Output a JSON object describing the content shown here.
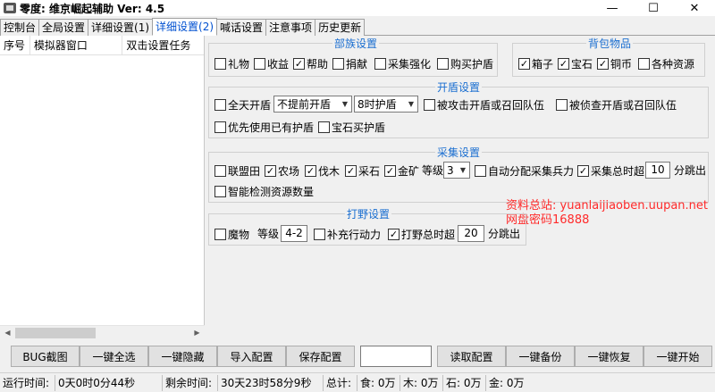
{
  "window": {
    "title": "零度: 维京崛起辅助 Ver:  4.5",
    "min": "—",
    "max": "☐",
    "close": "✕"
  },
  "tabs": [
    "控制台",
    "全局设置",
    "详细设置(1)",
    "详细设置(2)",
    "喊话设置",
    "注意事项",
    "历史更新"
  ],
  "list": {
    "columns": [
      "序号",
      "模拟器窗口",
      "双击设置任务"
    ]
  },
  "tribe": {
    "title": "部族设置",
    "items": [
      {
        "label": "礼物",
        "checked": false
      },
      {
        "label": "收益",
        "checked": false
      },
      {
        "label": "帮助",
        "checked": true
      },
      {
        "label": "捐献",
        "checked": false
      },
      {
        "label": "采集强化",
        "checked": false
      },
      {
        "label": "购买护盾",
        "checked": false
      }
    ]
  },
  "bag": {
    "title": "背包物品",
    "items": [
      {
        "label": "箱子",
        "checked": true
      },
      {
        "label": "宝石",
        "checked": true
      },
      {
        "label": "铜币",
        "checked": true
      },
      {
        "label": "各种资源",
        "checked": false
      }
    ]
  },
  "shield": {
    "title": "开盾设置",
    "allday": {
      "label": "全天开盾",
      "checked": false
    },
    "advance": "不提前开盾",
    "duration": "8时护盾",
    "attacked": {
      "label": "被攻击开盾或召回队伍",
      "checked": false
    },
    "scouted": {
      "label": "被侦查开盾或召回队伍",
      "checked": false
    },
    "use_existing": {
      "label": "优先使用已有护盾",
      "checked": false
    },
    "gem_buy": {
      "label": "宝石买护盾",
      "checked": false
    }
  },
  "gather": {
    "title": "采集设置",
    "items": [
      {
        "label": "联盟田",
        "checked": false
      },
      {
        "label": "农场",
        "checked": true
      },
      {
        "label": "伐木",
        "checked": true
      },
      {
        "label": "采石",
        "checked": true
      },
      {
        "label": "金矿",
        "checked": true
      }
    ],
    "level_label": "等级",
    "level": "3",
    "auto_alloc": {
      "label": "自动分配采集兵力",
      "checked": false
    },
    "total_timeout": {
      "label": "采集总时超",
      "checked": true
    },
    "timeout_value": "10",
    "timeout_suffix": "分跳出",
    "smart_detect": {
      "label": "智能检测资源数量",
      "checked": false
    }
  },
  "hunt": {
    "title": "打野设置",
    "monster": {
      "label": "魔物",
      "checked": false
    },
    "level_label": "等级",
    "level": "4-2",
    "refill": {
      "label": "补充行动力",
      "checked": false
    },
    "total_timeout": {
      "label": "打野总时超",
      "checked": true
    },
    "timeout_value": "20",
    "timeout_suffix": "分跳出"
  },
  "watermark": {
    "line1": "资料总站: yuanlaijiaoben.uupan.net",
    "line2": "网盘密码16888"
  },
  "buttons": [
    "BUG截图",
    "一键全选",
    "一键隐藏",
    "导入配置",
    "保存配置",
    "读取配置",
    "一键备份",
    "一键恢复",
    "一键开始"
  ],
  "status": {
    "run_label": "运行时间:",
    "run_value": "0天0时0分44秒",
    "remain_label": "剩余时间:",
    "remain_value": "30天23时58分9秒",
    "total": "总计:",
    "food": "食: 0万",
    "wood": "木: 0万",
    "stone": "石: 0万",
    "gold": "金: 0万"
  },
  "colors": {
    "accent": "#1a6ed0",
    "watermark": "#ff2a2a"
  }
}
